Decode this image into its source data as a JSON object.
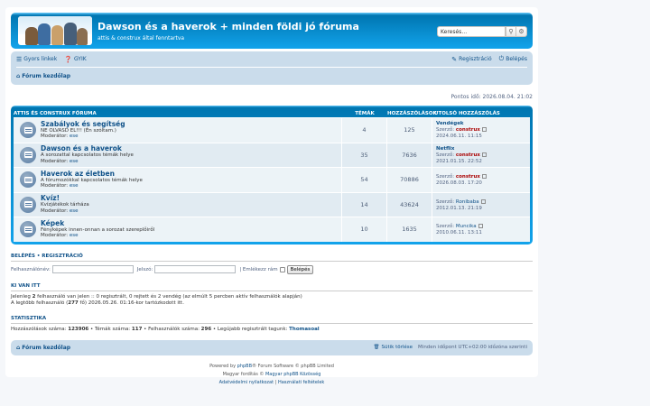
{
  "header": {
    "title": "Dawson és a haverok + minden földi jó fóruma",
    "description": "attis & construx által fenntartva",
    "search_placeholder": "Keresés…"
  },
  "navbar": {
    "quick_links": "Gyors linkek",
    "faq": "GYIK",
    "register": "Regisztráció",
    "login": "Belépés",
    "breadcrumb": "Fórum kezdőlap"
  },
  "current_time": "Pontos idő: 2026.08.04. 21:02",
  "forum_table": {
    "headers": {
      "forum": "ATTIS ÉS CONSTRUX FÓRUMA",
      "topics": "TÉMÁK",
      "posts": "HOZZÁSZÓLÁSOK",
      "last_post": "UTOLSÓ HOZZÁSZÓLÁS"
    },
    "rows": [
      {
        "name": "Szabályok és segítség",
        "desc": "NE OLVASD EL!!! (Én szóltam.)",
        "mod_label": "Moderátor:",
        "mod": "ese",
        "topics": "4",
        "posts": "125",
        "lp_title": "Vendégek",
        "lp_by": "Szerző:",
        "lp_author": "construx",
        "lp_time": "2024.06.11. 11:15"
      },
      {
        "name": "Dawson és a haverok",
        "desc": "A sorozattal kapcsolatos témák helye",
        "mod_label": "Moderátor:",
        "mod": "ese",
        "topics": "35",
        "posts": "7636",
        "lp_title": "Netflix",
        "lp_by": "Szerző:",
        "lp_author": "construx",
        "lp_time": "2021.01.15. 22:52"
      },
      {
        "name": "Haverok az életben",
        "desc": "A fórumozókkal kapcsolatos témák helye",
        "mod_label": "Moderátor:",
        "mod": "ese",
        "topics": "54",
        "posts": "70886",
        "lp_title": "",
        "lp_by": "Szerző:",
        "lp_author": "construx",
        "lp_time": "2026.08.03. 17:20"
      },
      {
        "name": "Kvíz!",
        "desc": "Kvízjátékok tárháza",
        "mod_label": "Moderátor:",
        "mod": "ese",
        "topics": "14",
        "posts": "43624",
        "lp_title": "",
        "lp_by": "Szerző:",
        "lp_author": "Ronibaba",
        "lp_time": "2012.01.13. 21:19"
      },
      {
        "name": "Képek",
        "desc": "Fényképek innen-onnan a sorozat szereplőiről",
        "mod_label": "Moderátor:",
        "mod": "ese",
        "topics": "10",
        "posts": "1635",
        "lp_title": "",
        "lp_by": "Szerző:",
        "lp_author": "Muncika",
        "lp_time": "2010.06.11. 13:11"
      }
    ]
  },
  "login_section": {
    "title": "BELÉPÉS  •  REGISZTRÁCIÓ",
    "username_label": "Felhasználónév:",
    "password_label": "Jelszó:",
    "remember_label": "| Emlékezz rám",
    "button": "Belépés"
  },
  "online": {
    "title": "KI VAN ITT",
    "line1_a": "Jelenleg ",
    "line1_count": "2",
    "line1_b": " felhasználó van jelen :: 0 regisztrált, 0 rejtett és 2 vendég (az elmúlt 5 percben aktív felhasználók alapján)",
    "line2_a": "A legtöbb felhasználó (",
    "line2_count": "277",
    "line2_b": " fő) 2026.05.26. 01:16-kor tartózkodott itt."
  },
  "stats": {
    "title": "STATISZTIKA",
    "posts_label": "Hozzászólások száma: ",
    "posts": "123906",
    "topics_label": " • Témák száma: ",
    "topics": "117",
    "users_label": " • Felhasználók száma: ",
    "users": "296",
    "newest_label": " • Legújabb regisztrált tagunk: ",
    "newest": "Thomasoal"
  },
  "footer_nav": {
    "home": "Fórum kezdőlap",
    "delete_cookies": "Sütik törlése",
    "timezone": "Minden időpont UTC+02:00 időzóna szerinti"
  },
  "copyright": {
    "powered_a": "Powered by ",
    "powered_link": "phpBB",
    "powered_b": "® Forum Software © phpBB Limited",
    "translation_a": "Magyar fordítás © ",
    "translation_link": "Magyar phpBB Közösség",
    "privacy": "Adatvédelmi nyilatkozat",
    "sep": " | ",
    "terms": "Használati feltételek"
  }
}
